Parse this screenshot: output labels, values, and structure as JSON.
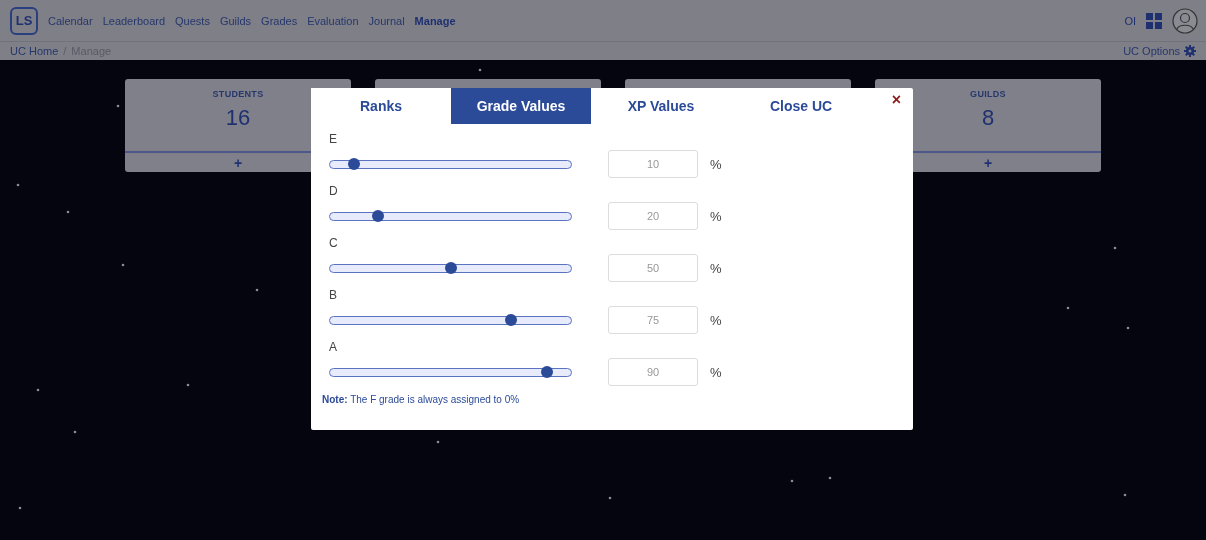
{
  "nav": {
    "logo": "LS",
    "items": [
      {
        "label": "Calendar",
        "selected": false
      },
      {
        "label": "Leaderboard",
        "selected": false
      },
      {
        "label": "Quests",
        "selected": false
      },
      {
        "label": "Guilds",
        "selected": false
      },
      {
        "label": "Grades",
        "selected": false
      },
      {
        "label": "Evaluation",
        "selected": false
      },
      {
        "label": "Journal",
        "selected": false
      },
      {
        "label": "Manage",
        "selected": true
      }
    ],
    "user_initials": "OI"
  },
  "breadcrumb": [
    "UC Home",
    "Manage"
  ],
  "breadcrumb_separator": "/",
  "options_label": "UC Options",
  "cards": [
    {
      "kind": "stat",
      "title": "STUDENTS",
      "value": "16",
      "action": "+"
    },
    {
      "kind": "covered"
    },
    {
      "kind": "covered"
    },
    {
      "kind": "stat",
      "title": "GUILDS",
      "value": "8",
      "action": "+"
    }
  ],
  "modal": {
    "tabs": [
      {
        "label": "Ranks",
        "selected": false
      },
      {
        "label": "Grade Values",
        "selected": true
      },
      {
        "label": "XP Values",
        "selected": false
      },
      {
        "label": "Close UC",
        "selected": false
      }
    ],
    "close": "×",
    "grades": [
      {
        "label": "E",
        "level": 0.1,
        "value": "10",
        "unit": "%"
      },
      {
        "label": "D",
        "level": 0.2,
        "value": "20",
        "unit": "%"
      },
      {
        "label": "C",
        "level": 0.5,
        "value": "50",
        "unit": "%"
      },
      {
        "label": "B",
        "level": 0.75,
        "value": "75",
        "unit": "%"
      },
      {
        "label": "A",
        "level": 0.9,
        "value": "90",
        "unit": "%"
      }
    ],
    "note": "**Note:**  The F grade is always assigned to 0%"
  }
}
